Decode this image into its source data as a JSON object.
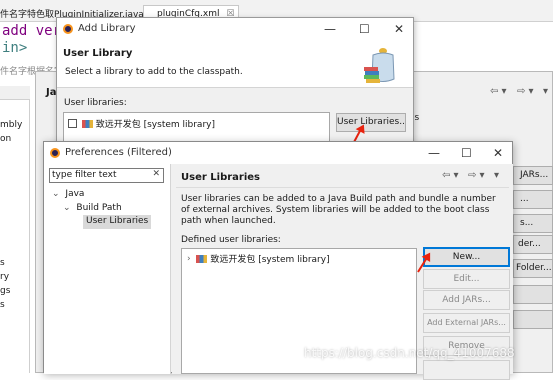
{
  "editor": {
    "tab1": "件名字特色取PluginInitializer.java",
    "tab2": "pluginCfg.xml",
    "tab2_close": "☒",
    "code_line1": "add version",
    "code_line2": "in>",
    "code_line3": "件名字根据名字",
    "left_items": [
      "mbly",
      "on",
      "s",
      "ry",
      "gs",
      "s"
    ]
  },
  "underlying": {
    "label_javab": "Jav",
    "right_buttons": [
      "JARs...",
      "...",
      "s...",
      "der...",
      "Folder..."
    ],
    "small_label": "es"
  },
  "add_library": {
    "title": "Add Library",
    "heading": "User Library",
    "description": "Select a library to add to the classpath.",
    "libraries_label": "User libraries:",
    "library_item": "致远开发包 [system library]",
    "user_libraries_button": "User Libraries..."
  },
  "preferences": {
    "title": "Preferences (Filtered)",
    "filter_value": "type filter text",
    "filter_clear": "✕",
    "tree": [
      {
        "label": "Java",
        "toggle": "⌄"
      },
      {
        "label": "Build Path",
        "toggle": "⌄"
      },
      {
        "label": "User Libraries",
        "toggle": ""
      }
    ],
    "page_title": "User Libraries",
    "description": "User libraries can be added to a Java Build path and bundle a number of external archives. System libraries will be added to the boot class path when launched.",
    "defined_label": "Defined user libraries:",
    "library_item": "致远开发包 [system library]",
    "library_toggle": "›",
    "buttons": {
      "new": "New...",
      "edit": "Edit...",
      "add_jars": "Add JARs...",
      "add_external_jars": "Add External JARs...",
      "remove": "Remove"
    }
  },
  "window_controls": {
    "minimize": "—",
    "maximize": "☐",
    "close": "✕"
  },
  "watermark": "https://blog.csdn.net/qq_41007688",
  "colors": {
    "arrow": "#e8230f",
    "selection": "#cce8ff",
    "accent": "#0078d7"
  }
}
